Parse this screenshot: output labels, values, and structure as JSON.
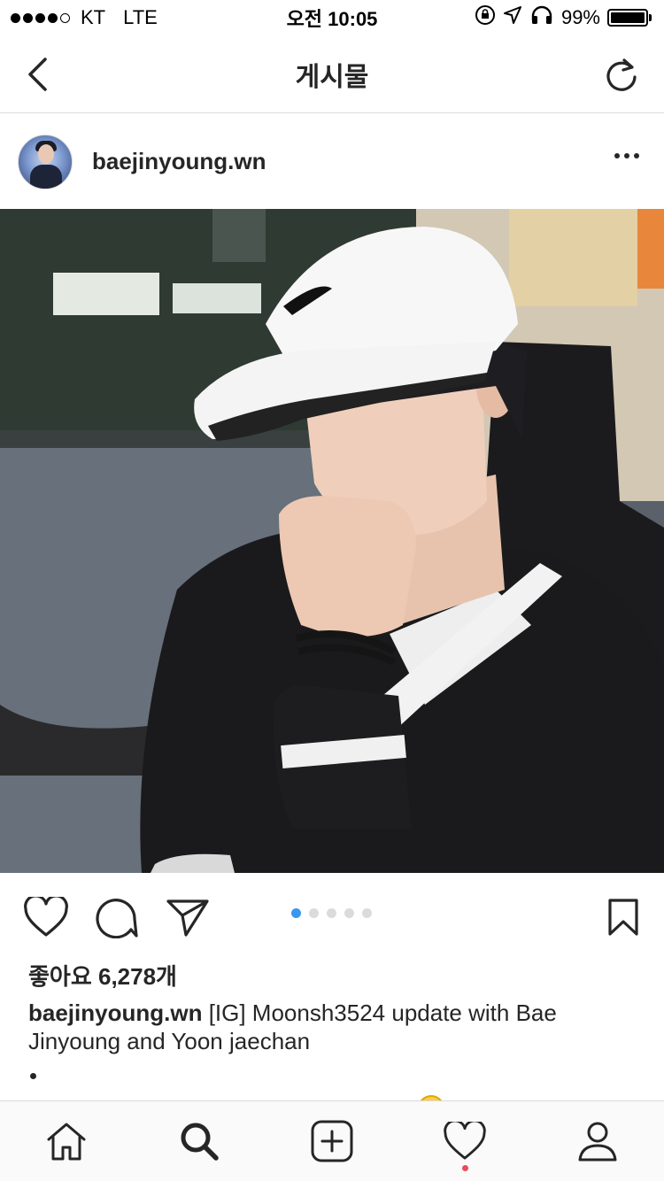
{
  "status_bar": {
    "carrier": "KT",
    "network": "LTE",
    "time": "오전 10:05",
    "battery": "99%",
    "icons": [
      "signal-dots-icon",
      "rotation-lock-icon",
      "location-arrow-icon",
      "headphones-icon",
      "battery-icon"
    ]
  },
  "header": {
    "title": "게시물",
    "icons": {
      "back": "chevron-left-icon",
      "refresh": "refresh-icon"
    }
  },
  "post": {
    "username": "baejinyoung.wn",
    "avatar_icon": "avatar",
    "more_icon": "more-dots-icon",
    "photo_alt": "photo",
    "carousel": {
      "count": 5,
      "active_index": 0
    },
    "actions": [
      "heart-icon",
      "comment-icon",
      "share-icon",
      "bookmark-icon"
    ],
    "likes_text": "좋아요 6,278개",
    "caption_username": "baejinyoung.wn",
    "caption_text": "[IG] Moonsh3524 update with Bae Jinyoung and Yoon jaechan",
    "caption_more": "•"
  },
  "tab_bar": {
    "tabs": [
      "home-icon",
      "search-icon",
      "new-post-icon",
      "activity-heart-icon",
      "profile-icon"
    ],
    "activity_notification": true
  },
  "colors": {
    "text": "#262626",
    "border": "#dbdbdb",
    "active_dot": "#3897f0",
    "notification": "#ed4956"
  }
}
